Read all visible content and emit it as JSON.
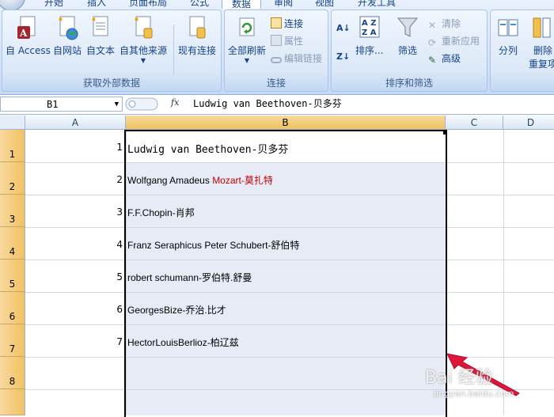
{
  "ribbon": {
    "tabs": [
      "开始",
      "插入",
      "页面布局",
      "公式",
      "数据",
      "审阅",
      "视图",
      "开发工具"
    ],
    "active_tab": "数据",
    "groups": {
      "external": {
        "title": "获取外部数据",
        "buttons": [
          "自 Access",
          "自网站",
          "自文本",
          "自其他来源",
          "现有连接"
        ]
      },
      "connections": {
        "title": "连接",
        "refresh_all": "全部刷新",
        "connections": "连接",
        "properties": "属性",
        "edit_links": "编辑链接"
      },
      "sort_filter": {
        "title": "排序和筛选",
        "sort": "排序...",
        "filter": "筛选",
        "clear": "清除",
        "reapply": "重新应用",
        "advanced": "高级"
      },
      "data_tools": {
        "split": "分列",
        "remove": "删除",
        "remove_line2": "重复项"
      }
    }
  },
  "formula_bar": {
    "name_box": "B1",
    "fx": "fx",
    "formula": "Ludwig van Beethoven-贝多芬"
  },
  "grid": {
    "columns": [
      "A",
      "B",
      "C",
      "D"
    ],
    "selected_column": "B",
    "rows": [
      "1",
      "2",
      "3",
      "4",
      "5",
      "6",
      "7",
      "8"
    ],
    "col_a": [
      "1",
      "2",
      "3",
      "4",
      "5",
      "6",
      "7"
    ],
    "col_b": [
      "Ludwig van Beethoven-贝多芬",
      "Wolfgang Amadeus ",
      "F.F.Chopin-肖邦",
      "Franz Seraphicus Peter Schubert-舒伯特",
      "robert schumann-罗伯特.舒曼",
      "GeorgesBize-乔治.比才",
      "HectorLouisBerlioz-柏辽兹"
    ],
    "b2_red": "Mozart-莫扎特"
  },
  "watermark": {
    "text": "Bai 经验",
    "url": "jingyan.baidu.com"
  },
  "colors": {
    "selected_header": "#f1c15f",
    "selection_fill": "#e7ebf5",
    "arrow": "#e0153a",
    "mozart_red": "#c00000"
  }
}
